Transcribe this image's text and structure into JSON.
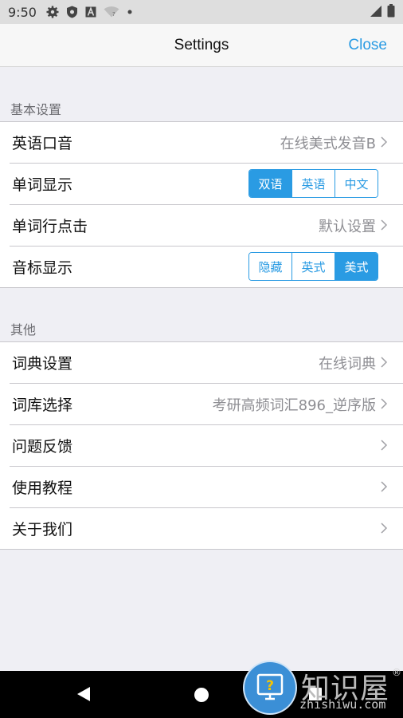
{
  "status_bar": {
    "time": "9:50",
    "icons": [
      "gear-icon",
      "shield-icon",
      "a-icon",
      "wifi-icon",
      "dot-icon"
    ],
    "right_icons": [
      "signal-icon",
      "battery-icon"
    ]
  },
  "nav": {
    "title": "Settings",
    "close_label": "Close",
    "accent": "#2a9be3"
  },
  "sections": {
    "basic": {
      "header": "基本设置",
      "rows": {
        "pronunciation": {
          "label": "英语口音",
          "value": "在线美式发音B"
        },
        "word_display": {
          "label": "单词显示",
          "options": [
            "双语",
            "英语",
            "中文"
          ],
          "selected": "双语"
        },
        "word_click": {
          "label": "单词行点击",
          "value": "默认设置"
        },
        "phonetic_display": {
          "label": "音标显示",
          "options": [
            "隐藏",
            "英式",
            "美式"
          ],
          "selected": "美式"
        }
      }
    },
    "other": {
      "header": "其他",
      "rows": {
        "dictionary": {
          "label": "词典设置",
          "value": "在线词典"
        },
        "word_bank": {
          "label": "词库选择",
          "value": "考研高频词汇896_逆序版"
        },
        "feedback": {
          "label": "问题反馈"
        },
        "tutorial": {
          "label": "使用教程"
        },
        "about": {
          "label": "关于我们"
        }
      }
    }
  },
  "system_nav": {
    "icons": [
      "back-icon",
      "home-icon",
      "recents-icon"
    ]
  },
  "watermark": {
    "logo_text": "知识屋",
    "registered": "®",
    "site": "zhishiwu.com"
  }
}
